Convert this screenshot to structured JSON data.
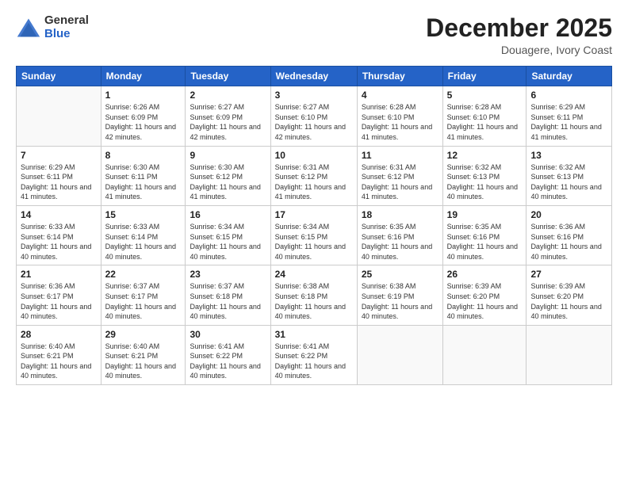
{
  "header": {
    "logo_general": "General",
    "logo_blue": "Blue",
    "title": "December 2025",
    "subtitle": "Douagere, Ivory Coast"
  },
  "days_of_week": [
    "Sunday",
    "Monday",
    "Tuesday",
    "Wednesday",
    "Thursday",
    "Friday",
    "Saturday"
  ],
  "weeks": [
    [
      {
        "day": "",
        "sunrise": "",
        "sunset": "",
        "daylight": ""
      },
      {
        "day": "1",
        "sunrise": "Sunrise: 6:26 AM",
        "sunset": "Sunset: 6:09 PM",
        "daylight": "Daylight: 11 hours and 42 minutes."
      },
      {
        "day": "2",
        "sunrise": "Sunrise: 6:27 AM",
        "sunset": "Sunset: 6:09 PM",
        "daylight": "Daylight: 11 hours and 42 minutes."
      },
      {
        "day": "3",
        "sunrise": "Sunrise: 6:27 AM",
        "sunset": "Sunset: 6:10 PM",
        "daylight": "Daylight: 11 hours and 42 minutes."
      },
      {
        "day": "4",
        "sunrise": "Sunrise: 6:28 AM",
        "sunset": "Sunset: 6:10 PM",
        "daylight": "Daylight: 11 hours and 41 minutes."
      },
      {
        "day": "5",
        "sunrise": "Sunrise: 6:28 AM",
        "sunset": "Sunset: 6:10 PM",
        "daylight": "Daylight: 11 hours and 41 minutes."
      },
      {
        "day": "6",
        "sunrise": "Sunrise: 6:29 AM",
        "sunset": "Sunset: 6:11 PM",
        "daylight": "Daylight: 11 hours and 41 minutes."
      }
    ],
    [
      {
        "day": "7",
        "sunrise": "Sunrise: 6:29 AM",
        "sunset": "Sunset: 6:11 PM",
        "daylight": "Daylight: 11 hours and 41 minutes."
      },
      {
        "day": "8",
        "sunrise": "Sunrise: 6:30 AM",
        "sunset": "Sunset: 6:11 PM",
        "daylight": "Daylight: 11 hours and 41 minutes."
      },
      {
        "day": "9",
        "sunrise": "Sunrise: 6:30 AM",
        "sunset": "Sunset: 6:12 PM",
        "daylight": "Daylight: 11 hours and 41 minutes."
      },
      {
        "day": "10",
        "sunrise": "Sunrise: 6:31 AM",
        "sunset": "Sunset: 6:12 PM",
        "daylight": "Daylight: 11 hours and 41 minutes."
      },
      {
        "day": "11",
        "sunrise": "Sunrise: 6:31 AM",
        "sunset": "Sunset: 6:12 PM",
        "daylight": "Daylight: 11 hours and 41 minutes."
      },
      {
        "day": "12",
        "sunrise": "Sunrise: 6:32 AM",
        "sunset": "Sunset: 6:13 PM",
        "daylight": "Daylight: 11 hours and 40 minutes."
      },
      {
        "day": "13",
        "sunrise": "Sunrise: 6:32 AM",
        "sunset": "Sunset: 6:13 PM",
        "daylight": "Daylight: 11 hours and 40 minutes."
      }
    ],
    [
      {
        "day": "14",
        "sunrise": "Sunrise: 6:33 AM",
        "sunset": "Sunset: 6:14 PM",
        "daylight": "Daylight: 11 hours and 40 minutes."
      },
      {
        "day": "15",
        "sunrise": "Sunrise: 6:33 AM",
        "sunset": "Sunset: 6:14 PM",
        "daylight": "Daylight: 11 hours and 40 minutes."
      },
      {
        "day": "16",
        "sunrise": "Sunrise: 6:34 AM",
        "sunset": "Sunset: 6:15 PM",
        "daylight": "Daylight: 11 hours and 40 minutes."
      },
      {
        "day": "17",
        "sunrise": "Sunrise: 6:34 AM",
        "sunset": "Sunset: 6:15 PM",
        "daylight": "Daylight: 11 hours and 40 minutes."
      },
      {
        "day": "18",
        "sunrise": "Sunrise: 6:35 AM",
        "sunset": "Sunset: 6:16 PM",
        "daylight": "Daylight: 11 hours and 40 minutes."
      },
      {
        "day": "19",
        "sunrise": "Sunrise: 6:35 AM",
        "sunset": "Sunset: 6:16 PM",
        "daylight": "Daylight: 11 hours and 40 minutes."
      },
      {
        "day": "20",
        "sunrise": "Sunrise: 6:36 AM",
        "sunset": "Sunset: 6:16 PM",
        "daylight": "Daylight: 11 hours and 40 minutes."
      }
    ],
    [
      {
        "day": "21",
        "sunrise": "Sunrise: 6:36 AM",
        "sunset": "Sunset: 6:17 PM",
        "daylight": "Daylight: 11 hours and 40 minutes."
      },
      {
        "day": "22",
        "sunrise": "Sunrise: 6:37 AM",
        "sunset": "Sunset: 6:17 PM",
        "daylight": "Daylight: 11 hours and 40 minutes."
      },
      {
        "day": "23",
        "sunrise": "Sunrise: 6:37 AM",
        "sunset": "Sunset: 6:18 PM",
        "daylight": "Daylight: 11 hours and 40 minutes."
      },
      {
        "day": "24",
        "sunrise": "Sunrise: 6:38 AM",
        "sunset": "Sunset: 6:18 PM",
        "daylight": "Daylight: 11 hours and 40 minutes."
      },
      {
        "day": "25",
        "sunrise": "Sunrise: 6:38 AM",
        "sunset": "Sunset: 6:19 PM",
        "daylight": "Daylight: 11 hours and 40 minutes."
      },
      {
        "day": "26",
        "sunrise": "Sunrise: 6:39 AM",
        "sunset": "Sunset: 6:20 PM",
        "daylight": "Daylight: 11 hours and 40 minutes."
      },
      {
        "day": "27",
        "sunrise": "Sunrise: 6:39 AM",
        "sunset": "Sunset: 6:20 PM",
        "daylight": "Daylight: 11 hours and 40 minutes."
      }
    ],
    [
      {
        "day": "28",
        "sunrise": "Sunrise: 6:40 AM",
        "sunset": "Sunset: 6:21 PM",
        "daylight": "Daylight: 11 hours and 40 minutes."
      },
      {
        "day": "29",
        "sunrise": "Sunrise: 6:40 AM",
        "sunset": "Sunset: 6:21 PM",
        "daylight": "Daylight: 11 hours and 40 minutes."
      },
      {
        "day": "30",
        "sunrise": "Sunrise: 6:41 AM",
        "sunset": "Sunset: 6:22 PM",
        "daylight": "Daylight: 11 hours and 40 minutes."
      },
      {
        "day": "31",
        "sunrise": "Sunrise: 6:41 AM",
        "sunset": "Sunset: 6:22 PM",
        "daylight": "Daylight: 11 hours and 40 minutes."
      },
      {
        "day": "",
        "sunrise": "",
        "sunset": "",
        "daylight": ""
      },
      {
        "day": "",
        "sunrise": "",
        "sunset": "",
        "daylight": ""
      },
      {
        "day": "",
        "sunrise": "",
        "sunset": "",
        "daylight": ""
      }
    ]
  ]
}
